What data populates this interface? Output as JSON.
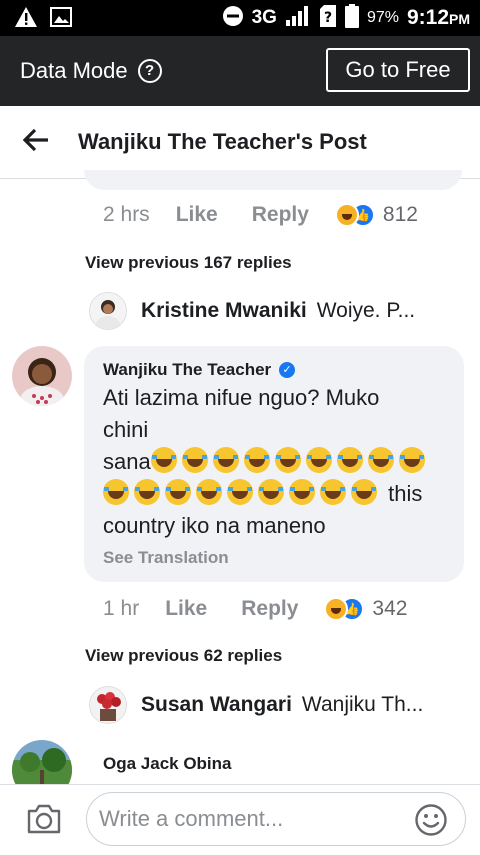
{
  "status_bar": {
    "network": "3G",
    "battery": "97%",
    "time": "9:12",
    "ampm": "PM"
  },
  "data_bar": {
    "label": "Data Mode",
    "help_glyph": "?",
    "go_free": "Go to Free"
  },
  "header": {
    "title": "Wanjiku The Teacher's Post"
  },
  "first_meta": {
    "time": "2 hrs",
    "like": "Like",
    "reply": "Reply",
    "count": "812"
  },
  "view_prev_1": "View previous 167 replies",
  "reply_1": {
    "name": "Kristine Mwaniki",
    "text": "Woiye. P..."
  },
  "main_comment": {
    "author": "Wanjiku The Teacher",
    "line1": "Ati lazima nifue nguo? Muko",
    "line2": "chini",
    "line3_text": "sana",
    "line4_text": "this",
    "line5": "country iko na maneno",
    "see_translation": "See Translation",
    "emoji_name": "tears-of-joy-emoji"
  },
  "second_meta": {
    "time": "1 hr",
    "like": "Like",
    "reply": "Reply",
    "count": "342"
  },
  "view_prev_2": "View previous 62 replies",
  "reply_2": {
    "name": "Susan Wangari",
    "text": "Wanjiku Th..."
  },
  "next_comment": {
    "author": "Oga Jack Obina"
  },
  "composer": {
    "placeholder": "Write a comment..."
  },
  "colors": {
    "facebook_blue": "#1877f2",
    "bubble_bg": "#f0f2f5",
    "data_bar_bg": "#242526"
  }
}
